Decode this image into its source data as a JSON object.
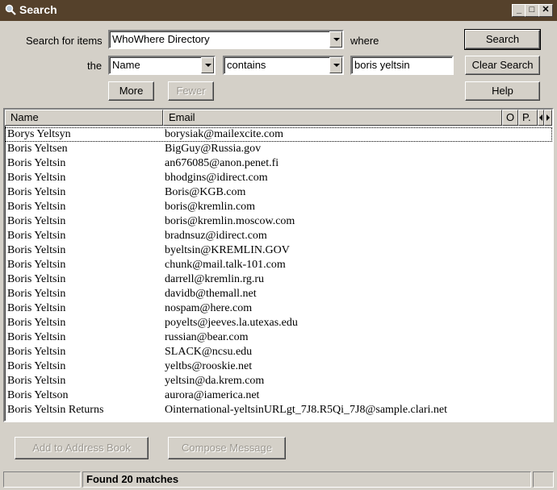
{
  "window": {
    "title": "Search"
  },
  "controls": {
    "search_for_label": "Search for items",
    "directory_value": "WhoWhere Directory",
    "where_label": "where",
    "the_label": "the",
    "field_value": "Name",
    "condition_value": "contains",
    "query_value": "boris yeltsin"
  },
  "buttons": {
    "search": "Search",
    "clear_search": "Clear Search",
    "help": "Help",
    "more": "More",
    "fewer": "Fewer",
    "add_to_address_book": "Add to Address Book",
    "compose_message": "Compose Message"
  },
  "list": {
    "columns": [
      "Name",
      "Email",
      "O",
      "P."
    ],
    "rows": [
      {
        "name": "Borys Yeltsyn",
        "email": "borysiak@mailexcite.com"
      },
      {
        "name": "Boris Yeltsen",
        "email": "BigGuy@Russia.gov"
      },
      {
        "name": "Boris Yeltsin",
        "email": "an676085@anon.penet.fi"
      },
      {
        "name": "Boris Yeltsin",
        "email": "bhodgins@idirect.com"
      },
      {
        "name": "Boris Yeltsin",
        "email": "Boris@KGB.com"
      },
      {
        "name": "Boris Yeltsin",
        "email": "boris@kremlin.com"
      },
      {
        "name": "Boris Yeltsin",
        "email": "boris@kremlin.moscow.com"
      },
      {
        "name": "Boris Yeltsin",
        "email": "bradnsuz@idirect.com"
      },
      {
        "name": "Boris Yeltsin",
        "email": "byeltsin@KREMLIN.GOV"
      },
      {
        "name": "Boris Yeltsin",
        "email": "chunk@mail.talk-101.com"
      },
      {
        "name": "Boris Yeltsin",
        "email": "darrell@kremlin.rg.ru"
      },
      {
        "name": "Boris Yeltsin",
        "email": "davidb@themall.net"
      },
      {
        "name": "Boris Yeltsin",
        "email": "nospam@here.com"
      },
      {
        "name": "Boris Yeltsin",
        "email": "poyelts@jeeves.la.utexas.edu"
      },
      {
        "name": "Boris Yeltsin",
        "email": "russian@bear.com"
      },
      {
        "name": "Boris Yeltsin",
        "email": "SLACK@ncsu.edu"
      },
      {
        "name": "Boris Yeltsin",
        "email": "yeltbs@rooskie.net"
      },
      {
        "name": "Boris Yeltsin",
        "email": "yeltsin@da.krem.com"
      },
      {
        "name": "Boris Yeltson",
        "email": "aurora@iamerica.net"
      },
      {
        "name": "Boris Yeltsin Returns",
        "email": "Ointernational-yeltsinURLgt_7J8.R5Qi_7J8@sample.clari.net"
      }
    ]
  },
  "status": {
    "message": "Found 20 matches"
  },
  "icons": {
    "window_icon": "magnifier-icon"
  }
}
